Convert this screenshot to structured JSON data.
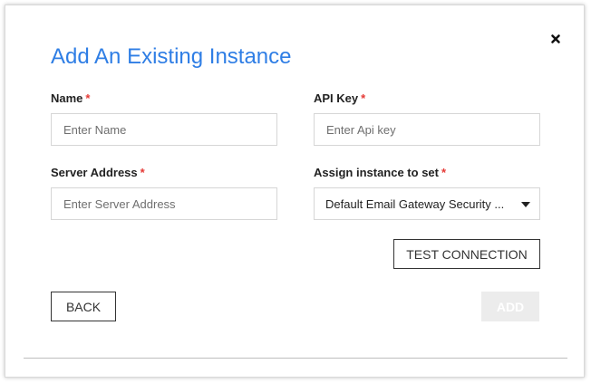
{
  "dialog": {
    "title": "Add An Existing Instance",
    "close_icon": "close-icon",
    "required_marker": "*"
  },
  "fields": {
    "name": {
      "label": "Name",
      "placeholder": "Enter Name",
      "value": ""
    },
    "api_key": {
      "label": "API Key",
      "placeholder": "Enter Api key",
      "value": ""
    },
    "server_address": {
      "label": "Server Address",
      "placeholder": "Enter Server Address",
      "value": ""
    },
    "assign_set": {
      "label": "Assign instance to set",
      "selected": "Default Email Gateway Security ..."
    }
  },
  "buttons": {
    "test_connection": "TEST CONNECTION",
    "back": "BACK",
    "add": "ADD"
  },
  "colors": {
    "title": "#2f7ee5",
    "required": "#e53935",
    "disabled_button": "#ececec"
  }
}
